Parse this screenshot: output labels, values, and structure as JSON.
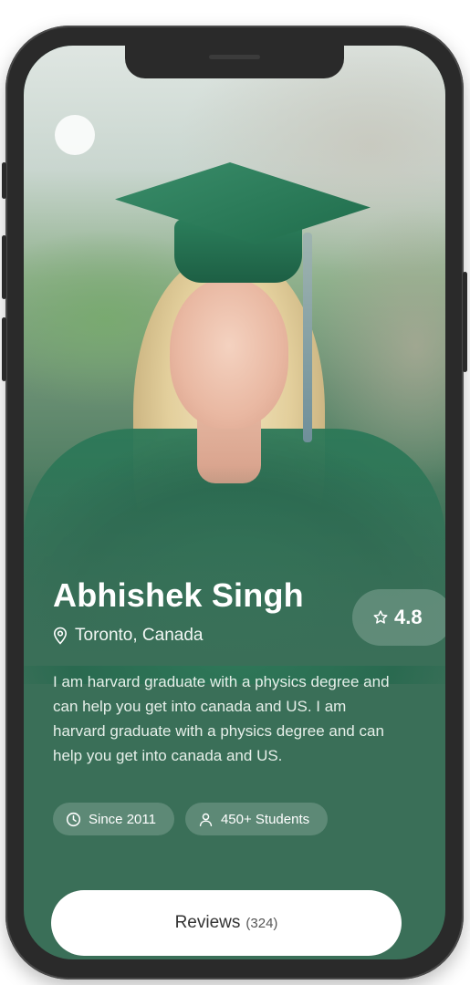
{
  "profile": {
    "name": "Abhishek Singh",
    "location": "Toronto, Canada",
    "rating": "4.8",
    "bio": "I am harvard graduate with a physics degree and can help you get into canada and US. I am harvard graduate with a physics degree and can help you get into canada and US."
  },
  "stats": {
    "since": "Since 2011",
    "students": "450+ Students"
  },
  "reviews_button": {
    "label": "Reviews",
    "count": "(324)"
  },
  "icons": {
    "back": "back-icon",
    "location": "location-pin-icon",
    "rating": "star-icon",
    "since": "clock-icon",
    "students": "user-icon"
  },
  "colors": {
    "card_background": "#3a6f58",
    "button_background": "#ffffff",
    "text_primary": "#ffffff"
  }
}
